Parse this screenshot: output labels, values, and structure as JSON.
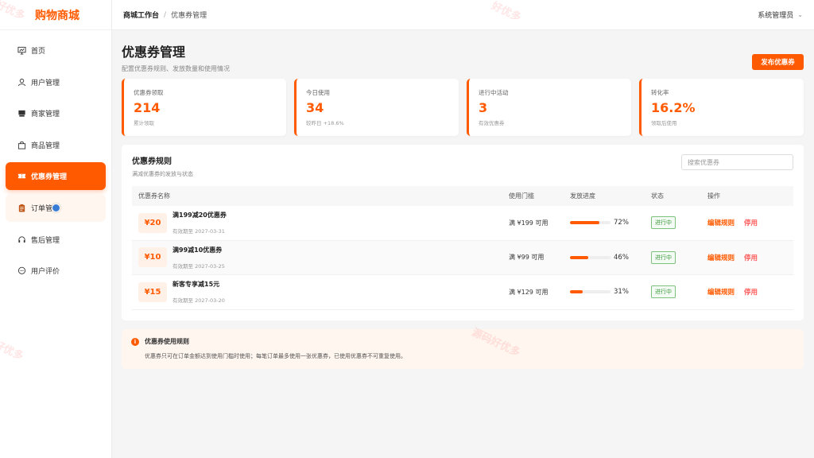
{
  "brand": "购物商城",
  "nav": [
    {
      "label": "首页",
      "icon": "chart-icon"
    },
    {
      "label": "用户管理",
      "icon": "user-icon"
    },
    {
      "label": "商家管理",
      "icon": "shop-icon"
    },
    {
      "label": "商品管理",
      "icon": "bag-icon"
    },
    {
      "label": "优惠券管理",
      "icon": "ticket-icon"
    },
    {
      "label": "订单管",
      "icon": "clipboard-icon"
    },
    {
      "label": "售后管理",
      "icon": "headset-icon"
    },
    {
      "label": "用户评价",
      "icon": "comment-icon"
    }
  ],
  "breadcrumb": {
    "root": "商城工作台",
    "sep": "/",
    "current": "优惠券管理"
  },
  "user": {
    "name": "系统管理员"
  },
  "page": {
    "title": "优惠券管理",
    "subtitle": "配置优惠券规则、发放数量和使用情况",
    "publish_label": "发布优惠券"
  },
  "stats": [
    {
      "label": "优惠券领取",
      "value": "214",
      "note": "累计领取"
    },
    {
      "label": "今日使用",
      "value": "34",
      "note": "较昨日 +18.6%"
    },
    {
      "label": "进行中活动",
      "value": "3",
      "note": "有效优惠券"
    },
    {
      "label": "转化率",
      "value": "16.2%",
      "note": "领取后使用"
    }
  ],
  "rules": {
    "title": "优惠券规则",
    "subtitle": "满减优惠券的发放与状态",
    "search_placeholder": "搜索优惠券",
    "columns": [
      "优惠券名称",
      "使用门槛",
      "发放进度",
      "状态",
      "操作"
    ],
    "rows": [
      {
        "amount": "¥20",
        "name": "满199减20优惠券",
        "expiry": "有效期至 2027-03-31",
        "threshold": "满 ¥199 可用",
        "progress": 72,
        "progress_text": "72%",
        "status": "进行中",
        "edit": "编辑规则",
        "stop": "停用"
      },
      {
        "amount": "¥10",
        "name": "满99减10优惠券",
        "expiry": "有效期至 2027-03-25",
        "threshold": "满 ¥99 可用",
        "progress": 46,
        "progress_text": "46%",
        "status": "进行中",
        "edit": "编辑规则",
        "stop": "停用"
      },
      {
        "amount": "¥15",
        "name": "新客专享减15元",
        "expiry": "有效期至 2027-03-20",
        "threshold": "满 ¥129 可用",
        "progress": 31,
        "progress_text": "31%",
        "status": "进行中",
        "edit": "编辑规则",
        "stop": "停用"
      }
    ]
  },
  "notice": {
    "title": "优惠券使用规则",
    "text": "优惠券只可在订单金额达到使用门槛时使用；每笔订单最多使用一张优惠券，已使用优惠券不可重复使用。"
  },
  "watermark": "源码好优多",
  "watermark_partial_a": "好优多",
  "watermark_partial_b": "好优多",
  "colors": {
    "accent": "#ff5a00",
    "status_green": "#3a9a3a"
  }
}
